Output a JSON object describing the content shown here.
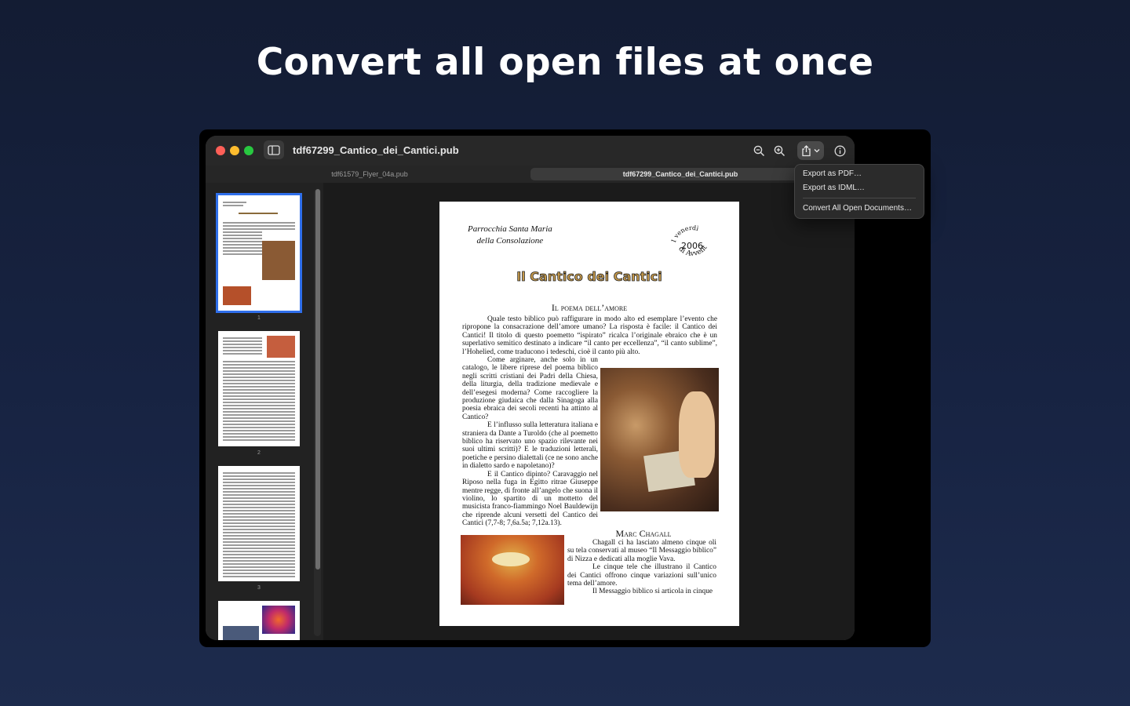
{
  "headline": "Convert all open files at once",
  "window": {
    "title": "tdf67299_Cantico_dei_Cantici.pub",
    "tabs": [
      {
        "label": "tdf61579_Flyer_04a.pub",
        "active": false
      },
      {
        "label": "tdf67299_Cantico_dei_Cantici.pub",
        "active": true
      }
    ],
    "toolbar_icons": [
      "sidebar-toggle-icon",
      "zoom-out-icon",
      "zoom-in-icon",
      "share-icon",
      "info-icon"
    ]
  },
  "export_menu": {
    "items": [
      "Export as PDF…",
      "Export as IDML…",
      "Convert All Open Documents…"
    ]
  },
  "sidebar": {
    "pages": [
      "1",
      "2",
      "3"
    ],
    "selected_page": "1"
  },
  "document": {
    "parish_line1": "Parrocchia Santa Maria",
    "parish_line2": "della Consolazione",
    "seal_year": "2006",
    "seal_top_text": "I venerdì",
    "seal_bottom_text": "di Avvento",
    "title": "Il Cantico dei Cantici",
    "section1_heading": "Il poema dell’amore",
    "section1_p1": "Quale testo biblico può raffigurare in modo alto ed esemplare l’evento che ripropone la consacrazione dell’amore umano? La risposta è facile: il Cantico dei Cantici! Il titolo di questo poemetto “ispirato” ricalca l’originale ebraico che è un superlativo semitico destinato a indicare “il canto per eccellenza”, “il canto sublime”, l’Hohelied, come traducono i tedeschi, cioè il canto più alto.",
    "section1_p2": "Come arginare, anche solo in un catalogo, le libere riprese del poema biblico negli scritti cristiani dei Padri della Chiesa, della liturgia, della tradizione medievale e dell’esegesi moderna? Come raccogliere la produzione giudaica che dalla Sinagoga alla poesia ebraica dei secoli recenti ha attinto al Cantico?",
    "section1_p3": "E l’influsso sulla letteratura italiana e straniera da Dante a Turoldo (che al poemetto biblico ha riservato uno spazio rilevante nei suoi ultimi scritti)? E le traduzioni letterali, poetiche e persino dialettali (ce ne sono anche in dialetto sardo e napoletano)?",
    "section1_p4": "E il Cantico dipinto? Caravaggio nel Riposo nella fuga in Egitto ritrae Giuseppe mentre regge, di fronte all’angelo che suona il violino, lo spartito di un mottetto del musicista franco-fiammingo Noel Bauldewijn che riprende alcuni versetti del Cantico dei Cantici (7,7-8; 7,6a.5a; 7,12a.13).",
    "section2_heading": "Marc Chagall",
    "section2_p1": "Chagall ci ha lasciato almeno cinque oli su tela conservati al museo “Il Messaggio biblico” di Nizza e dedicati alla moglie Vava.",
    "section2_p2": "Le cinque tele che illustrano il Cantico dei Cantici offrono cinque variazioni sull’unico tema dell’amore.",
    "section2_p3": "Il Messaggio biblico si articola in cinque"
  },
  "colors": {
    "accent_selection": "#2f6feb",
    "close": "#fe5f57",
    "minimize": "#febc2e",
    "zoom": "#28c840",
    "title_gold": "#c69a4b"
  }
}
